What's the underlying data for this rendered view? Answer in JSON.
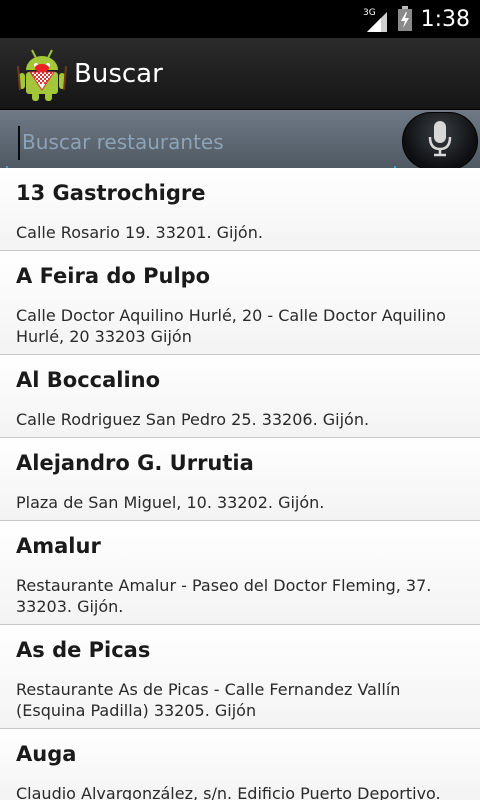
{
  "status_bar": {
    "network": "3G",
    "time": "1:38"
  },
  "action_bar": {
    "title": "Buscar"
  },
  "search": {
    "placeholder": "Buscar restaurantes",
    "value": ""
  },
  "colors": {
    "accent": "#3aa6d8",
    "action_bar": "#1c1c1c",
    "search_bar": "#5e6873"
  },
  "restaurants": [
    {
      "name": "13 Gastrochigre",
      "address": "Calle Rosario 19. 33201. Gijón."
    },
    {
      "name": "A Feira do Pulpo",
      "address": "Calle Doctor Aquilino Hurlé, 20 - Calle Doctor Aquilino Hurlé, 20 33203 Gijón"
    },
    {
      "name": "Al Boccalino",
      "address": "Calle Rodriguez San Pedro 25. 33206. Gijón."
    },
    {
      "name": "Alejandro G. Urrutia",
      "address": "Plaza de San Miguel, 10. 33202. Gijón."
    },
    {
      "name": "Amalur",
      "address": "Restaurante Amalur - Paseo del Doctor Fleming, 37. 33203. Gijón."
    },
    {
      "name": "As de Picas",
      "address": "Restaurante As de Picas - Calle Fernandez Vallín (Esquina Padilla) 33205. Gijón"
    },
    {
      "name": "Auga",
      "address": "Claudio Alvargonzález, s/n. Edificio Puerto Deportivo."
    }
  ]
}
